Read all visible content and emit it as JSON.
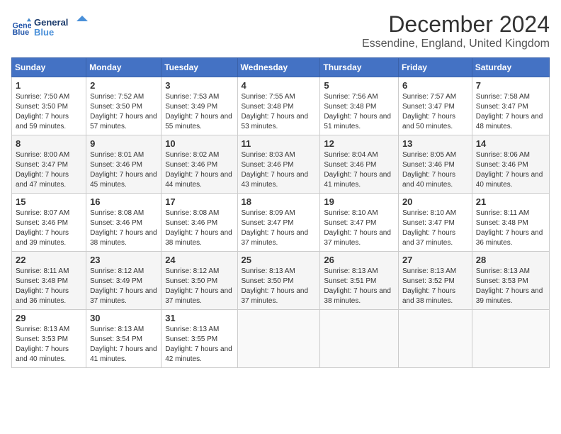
{
  "header": {
    "title": "December 2024",
    "subtitle": "Essendine, England, United Kingdom",
    "logo_line1": "General",
    "logo_line2": "Blue"
  },
  "calendar": {
    "days_of_week": [
      "Sunday",
      "Monday",
      "Tuesday",
      "Wednesday",
      "Thursday",
      "Friday",
      "Saturday"
    ],
    "weeks": [
      [
        {
          "day": "1",
          "sunrise": "7:50 AM",
          "sunset": "3:50 PM",
          "daylight": "7 hours and 59 minutes."
        },
        {
          "day": "2",
          "sunrise": "7:52 AM",
          "sunset": "3:50 PM",
          "daylight": "7 hours and 57 minutes."
        },
        {
          "day": "3",
          "sunrise": "7:53 AM",
          "sunset": "3:49 PM",
          "daylight": "7 hours and 55 minutes."
        },
        {
          "day": "4",
          "sunrise": "7:55 AM",
          "sunset": "3:48 PM",
          "daylight": "7 hours and 53 minutes."
        },
        {
          "day": "5",
          "sunrise": "7:56 AM",
          "sunset": "3:48 PM",
          "daylight": "7 hours and 51 minutes."
        },
        {
          "day": "6",
          "sunrise": "7:57 AM",
          "sunset": "3:47 PM",
          "daylight": "7 hours and 50 minutes."
        },
        {
          "day": "7",
          "sunrise": "7:58 AM",
          "sunset": "3:47 PM",
          "daylight": "7 hours and 48 minutes."
        }
      ],
      [
        {
          "day": "8",
          "sunrise": "8:00 AM",
          "sunset": "3:47 PM",
          "daylight": "7 hours and 47 minutes."
        },
        {
          "day": "9",
          "sunrise": "8:01 AM",
          "sunset": "3:46 PM",
          "daylight": "7 hours and 45 minutes."
        },
        {
          "day": "10",
          "sunrise": "8:02 AM",
          "sunset": "3:46 PM",
          "daylight": "7 hours and 44 minutes."
        },
        {
          "day": "11",
          "sunrise": "8:03 AM",
          "sunset": "3:46 PM",
          "daylight": "7 hours and 43 minutes."
        },
        {
          "day": "12",
          "sunrise": "8:04 AM",
          "sunset": "3:46 PM",
          "daylight": "7 hours and 41 minutes."
        },
        {
          "day": "13",
          "sunrise": "8:05 AM",
          "sunset": "3:46 PM",
          "daylight": "7 hours and 40 minutes."
        },
        {
          "day": "14",
          "sunrise": "8:06 AM",
          "sunset": "3:46 PM",
          "daylight": "7 hours and 40 minutes."
        }
      ],
      [
        {
          "day": "15",
          "sunrise": "8:07 AM",
          "sunset": "3:46 PM",
          "daylight": "7 hours and 39 minutes."
        },
        {
          "day": "16",
          "sunrise": "8:08 AM",
          "sunset": "3:46 PM",
          "daylight": "7 hours and 38 minutes."
        },
        {
          "day": "17",
          "sunrise": "8:08 AM",
          "sunset": "3:46 PM",
          "daylight": "7 hours and 38 minutes."
        },
        {
          "day": "18",
          "sunrise": "8:09 AM",
          "sunset": "3:47 PM",
          "daylight": "7 hours and 37 minutes."
        },
        {
          "day": "19",
          "sunrise": "8:10 AM",
          "sunset": "3:47 PM",
          "daylight": "7 hours and 37 minutes."
        },
        {
          "day": "20",
          "sunrise": "8:10 AM",
          "sunset": "3:47 PM",
          "daylight": "7 hours and 37 minutes."
        },
        {
          "day": "21",
          "sunrise": "8:11 AM",
          "sunset": "3:48 PM",
          "daylight": "7 hours and 36 minutes."
        }
      ],
      [
        {
          "day": "22",
          "sunrise": "8:11 AM",
          "sunset": "3:48 PM",
          "daylight": "7 hours and 36 minutes."
        },
        {
          "day": "23",
          "sunrise": "8:12 AM",
          "sunset": "3:49 PM",
          "daylight": "7 hours and 37 minutes."
        },
        {
          "day": "24",
          "sunrise": "8:12 AM",
          "sunset": "3:50 PM",
          "daylight": "7 hours and 37 minutes."
        },
        {
          "day": "25",
          "sunrise": "8:13 AM",
          "sunset": "3:50 PM",
          "daylight": "7 hours and 37 minutes."
        },
        {
          "day": "26",
          "sunrise": "8:13 AM",
          "sunset": "3:51 PM",
          "daylight": "7 hours and 38 minutes."
        },
        {
          "day": "27",
          "sunrise": "8:13 AM",
          "sunset": "3:52 PM",
          "daylight": "7 hours and 38 minutes."
        },
        {
          "day": "28",
          "sunrise": "8:13 AM",
          "sunset": "3:53 PM",
          "daylight": "7 hours and 39 minutes."
        }
      ],
      [
        {
          "day": "29",
          "sunrise": "8:13 AM",
          "sunset": "3:53 PM",
          "daylight": "7 hours and 40 minutes."
        },
        {
          "day": "30",
          "sunrise": "8:13 AM",
          "sunset": "3:54 PM",
          "daylight": "7 hours and 41 minutes."
        },
        {
          "day": "31",
          "sunrise": "8:13 AM",
          "sunset": "3:55 PM",
          "daylight": "7 hours and 42 minutes."
        },
        null,
        null,
        null,
        null
      ]
    ],
    "labels": {
      "sunrise": "Sunrise:",
      "sunset": "Sunset:",
      "daylight": "Daylight:"
    }
  }
}
